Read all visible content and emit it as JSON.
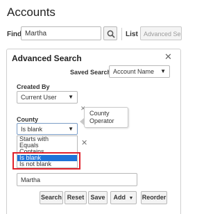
{
  "page": {
    "title": "Accounts"
  },
  "find": {
    "label": "Find",
    "value": "Martha"
  },
  "list": {
    "label": "List",
    "selected": "Advanced Search"
  },
  "advanced_search": {
    "title": "Advanced Search",
    "saved_search": {
      "label": "Saved Search",
      "selected": "Account Name"
    },
    "created_by": {
      "label": "Created By",
      "selected": "Current User"
    },
    "county": {
      "label": "County",
      "selected": "Is blank"
    },
    "tooltip_text": "County Operator",
    "operator_options": [
      "Starts with",
      "Equals",
      "Contains",
      "Is blank",
      "Is not blank"
    ],
    "selected_option_index": 3,
    "value": "Martha",
    "buttons": {
      "search": "Search",
      "reset": "Reset",
      "save": "Save",
      "add": "Add",
      "reorder": "Reorder"
    }
  },
  "icons": {
    "close": "close-icon",
    "search": "search-icon",
    "caret": "chevron-down-icon"
  },
  "colors": {
    "selected_option_bg": "#1e73d8",
    "highlight_border": "#e0212b"
  }
}
